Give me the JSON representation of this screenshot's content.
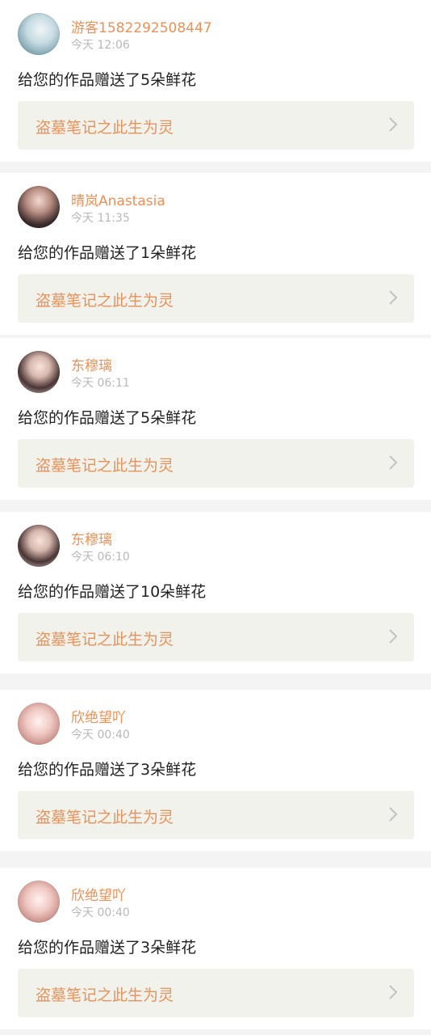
{
  "notifications": [
    {
      "user": "游客1582292508447",
      "time": "今天 12:06",
      "message": "给您的作品赠送了5朵鲜花",
      "work_title": "盗墓笔记之此生为灵",
      "avatar": "guest-avatar"
    },
    {
      "user": "晴岚Anastasia",
      "time": "今天 11:35",
      "message": "给您的作品赠送了1朵鲜花",
      "work_title": "盗墓笔记之此生为灵",
      "avatar": "girl-avatar"
    },
    {
      "user": "东穆璃",
      "time": "今天 06:11",
      "message": "给您的作品赠送了5朵鲜花",
      "work_title": "盗墓笔记之此生为灵",
      "avatar": "girl-avatar"
    },
    {
      "user": "东穆璃",
      "time": "今天 06:10",
      "message": "给您的作品赠送了10朵鲜花",
      "work_title": "盗墓笔记之此生为灵",
      "avatar": "girl-avatar"
    },
    {
      "user": "欣绝望吖",
      "time": "今天 00:40",
      "message": "给您的作品赠送了3朵鲜花",
      "work_title": "盗墓笔记之此生为灵",
      "avatar": "cat-avatar"
    },
    {
      "user": "欣绝望吖",
      "time": "今天 00:40",
      "message": "给您的作品赠送了3朵鲜花",
      "work_title": "盗墓笔记之此生为灵",
      "avatar": "cat-avatar"
    }
  ],
  "colors": {
    "accent": "#e8925a",
    "background": "#f4f4f4",
    "card": "#ffffff",
    "work_box": "#f2f2ec",
    "timestamp": "#b8b8b8",
    "text": "#222222"
  },
  "icons": {
    "chevron": "chevron-right-icon"
  }
}
